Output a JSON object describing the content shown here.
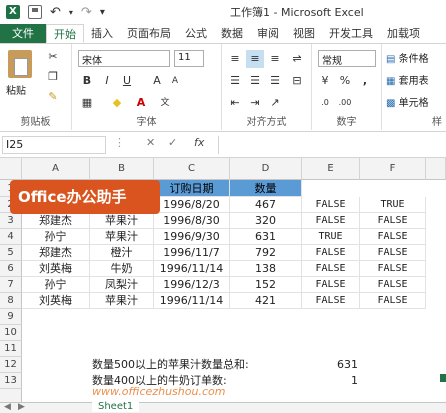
{
  "window": {
    "title": "工作簿1 - Microsoft Excel"
  },
  "tabs": [
    "文件",
    "开始",
    "插入",
    "页面布局",
    "公式",
    "数据",
    "审阅",
    "视图",
    "开发工具",
    "加载项"
  ],
  "ribbon": {
    "paste": "粘贴",
    "clipboard": "剪贴板",
    "font_name": "宋体",
    "font_size": "11",
    "bold": "B",
    "italic": "I",
    "underline": "U",
    "font_group": "字体",
    "align_group": "对齐方式",
    "number_format": "常规",
    "percent": "%",
    "comma": ",",
    "number_group": "数字",
    "cond_format": "条件格",
    "table_format": "套用表",
    "cell_style": "单元格",
    "styles_group": "样"
  },
  "formula_bar": {
    "name_box": "I25",
    "fx": "fx",
    "formula": ""
  },
  "columns": [
    "A",
    "B",
    "C",
    "D",
    "E",
    "F"
  ],
  "rows": [
    "1",
    "2",
    "3",
    "4",
    "5",
    "6",
    "7",
    "8",
    "9",
    "10",
    "11",
    "12",
    "13"
  ],
  "logo_text": "Office办公助手",
  "watermark": "www.officezhushou.com",
  "headers": {
    "date": "订购日期",
    "qty": "数量"
  },
  "data": [
    {
      "a": "",
      "b": "",
      "c": "1996/8/20",
      "d": "467",
      "e": "FALSE",
      "f": "TRUE"
    },
    {
      "a": "郑建杰",
      "b": "苹果汁",
      "c": "1996/8/30",
      "d": "320",
      "e": "FALSE",
      "f": "FALSE"
    },
    {
      "a": "孙宁",
      "b": "苹果汁",
      "c": "1996/9/30",
      "d": "631",
      "e": "TRUE",
      "f": "FALSE"
    },
    {
      "a": "郑建杰",
      "b": "橙汁",
      "c": "1996/11/7",
      "d": "792",
      "e": "FALSE",
      "f": "FALSE"
    },
    {
      "a": "刘英梅",
      "b": "牛奶",
      "c": "1996/11/14",
      "d": "138",
      "e": "FALSE",
      "f": "FALSE"
    },
    {
      "a": "孙宁",
      "b": "凤梨汁",
      "c": "1996/12/3",
      "d": "152",
      "e": "FALSE",
      "f": "FALSE"
    },
    {
      "a": "刘英梅",
      "b": "苹果汁",
      "c": "1996/11/14",
      "d": "421",
      "e": "FALSE",
      "f": "FALSE"
    }
  ],
  "summary": [
    {
      "label": "数量500以上的苹果汁数量总和:",
      "value": "631"
    },
    {
      "label": "数量400以上的牛奶订单数:",
      "value": "1"
    }
  ],
  "sheet_tab": "Sheet1",
  "colors": {
    "accent": "#217346",
    "header_fill": "#5b9bd5",
    "logo": "#d9541e"
  }
}
